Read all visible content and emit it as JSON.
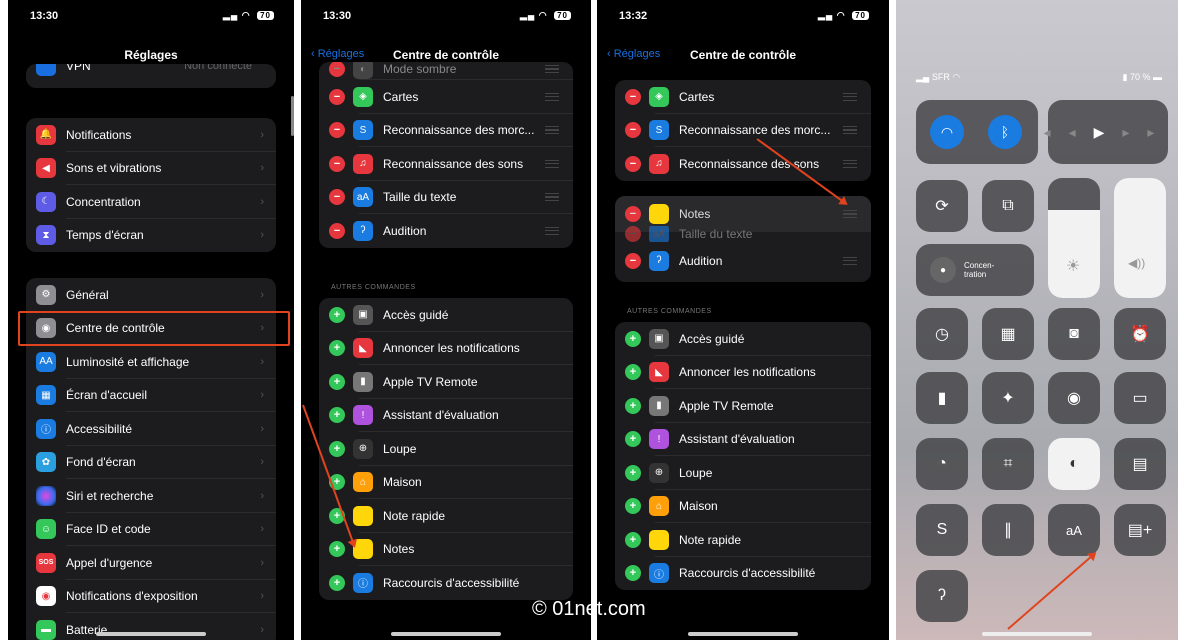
{
  "panel1": {
    "time": "13:30",
    "battery": "70",
    "title": "Réglages",
    "vpn": {
      "label": "VPN",
      "value": "Non connecté"
    },
    "group1": [
      "Notifications",
      "Sons et vibrations",
      "Concentration",
      "Temps d'écran"
    ],
    "group2": [
      "Général",
      "Centre de contrôle",
      "Luminosité et affichage",
      "Écran d'accueil",
      "Accessibilité",
      "Fond d'écran",
      "Siri et recherche",
      "Face ID et code",
      "Appel d'urgence",
      "Notifications d'exposition",
      "Batterie"
    ],
    "icon_colors": {
      "notifications": "#e5373d",
      "sons": "#e5373d",
      "concentration": "#5e5ce6",
      "temps": "#5e5ce6",
      "general": "#8e8e93",
      "centre": "#8e8e93",
      "luminosite": "#1a7be0",
      "accueil": "#1a7be0",
      "accessibilite": "#1a7be0",
      "fond": "#2aa0e0",
      "siri": "#333",
      "faceid": "#34c759",
      "urgence": "#e5373d",
      "exposition": "#fff",
      "batterie": "#34c759"
    }
  },
  "panel2": {
    "time": "13:30",
    "battery": "70",
    "back": "Réglages",
    "title": "Centre de contrôle",
    "included": [
      "Mode sombre",
      "Cartes",
      "Reconnaissance des morc...",
      "Reconnaissance des sons",
      "Taille du texte",
      "Audition"
    ],
    "section": "AUTRES COMMANDES",
    "more": [
      "Accès guidé",
      "Annoncer les notifications",
      "Apple TV Remote",
      "Assistant d'évaluation",
      "Loupe",
      "Maison",
      "Note rapide",
      "Notes",
      "Raccourcis d'accessibilité"
    ]
  },
  "panel3": {
    "time": "13:32",
    "battery": "70",
    "back": "Réglages",
    "title": "Centre de contrôle",
    "included": [
      "Cartes",
      "Reconnaissance des morc...",
      "Reconnaissance des sons"
    ],
    "dragging": "Notes",
    "hidden_below": "Taille du texte",
    "after": [
      "Audition"
    ],
    "section": "AUTRES COMMANDES",
    "more": [
      "Accès guidé",
      "Annoncer les notifications",
      "Apple TV Remote",
      "Assistant d'évaluation",
      "Loupe",
      "Maison",
      "Note rapide",
      "Raccourcis d'accessibilité"
    ]
  },
  "control_center": {
    "carrier": "SFR",
    "battery": "70 %",
    "focus_label": "Concen-\ntration"
  },
  "watermark": "© 01net.com"
}
